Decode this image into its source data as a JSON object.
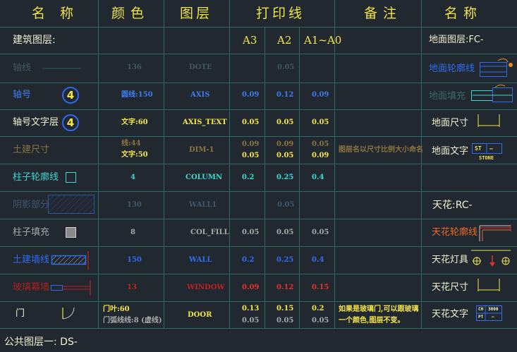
{
  "header": {
    "name_left": "名　称",
    "color": "颜 色",
    "layer": "图层",
    "print_line": "打印线",
    "note": "备 注",
    "name_right": "名 称"
  },
  "left_section_title": "建筑图层:",
  "right_section_title": "地面图层:FC-",
  "sizes": {
    "a3": "A3",
    "a2": "A2",
    "a1a0": "A1~A0"
  },
  "rows": [
    {
      "name": "轴线",
      "color": "136",
      "layer": "DOTE",
      "a3": "",
      "a2": "0.05",
      "a1": ""
    },
    {
      "name": "轴号",
      "badge": "4",
      "color": "圆线:150",
      "layer": "AXIS",
      "a3": "0.09",
      "a2": "0.12",
      "a1": "0.09"
    },
    {
      "name": "轴号文字层",
      "badge": "4",
      "color": "文字:60",
      "layer": "AXIS_TEXT",
      "a3": "0.05",
      "a2": "0.05",
      "a1": "0.05"
    },
    {
      "name": "土建尺寸",
      "color_line1": "线:44",
      "color_line2": "文字:50",
      "layer": "DIM-1",
      "a3_1": "0.09",
      "a3_2": "0.05",
      "a2_1": "0.09",
      "a2_2": "0.05",
      "a1_1": "0.05",
      "a1_2": "0.09",
      "note": "图层名以尺寸比例大小命名"
    },
    {
      "name": "柱子轮廓线",
      "color": "4",
      "layer": "COLUMN",
      "a3": "0.2",
      "a2": "0.25",
      "a1": "0.4"
    },
    {
      "name": "阴影部分",
      "color": "130",
      "layer": "WALL1",
      "a3": "",
      "a2": "0.05",
      "a1": ""
    },
    {
      "name": "柱子填充",
      "color": "8",
      "layer": "COL_FILL",
      "a3": "0.05",
      "a2": "0.05",
      "a1": "0.05"
    },
    {
      "name": "土建墙线",
      "color": "150",
      "layer": "WALL",
      "a3": "0.2",
      "a2": "0.25",
      "a1": "0.4"
    },
    {
      "name": "玻璃幕墙",
      "color": "13",
      "layer": "WINDOW",
      "a3": "0.09",
      "a2": "0.12",
      "a1": "0.15"
    },
    {
      "name": "门",
      "color_line1": "门叶:60",
      "color_line2": "门弧线线:8 (虚线)",
      "layer": "DOOR",
      "a3_1": "0.13",
      "a3_2": "0.05",
      "a2_1": "0.15",
      "a2_2": "0.05",
      "a1_1": "0.2",
      "a1_2": "0.05",
      "note_line1": "如果是玻璃门,可以跟玻璃",
      "note_line2": "一个颜色,图层不变。"
    }
  ],
  "right_items": {
    "floor_outline": "地面轮廓线",
    "floor_fill": "地面填充",
    "floor_dim": "地面尺寸",
    "floor_text": "地面文字",
    "floor_text_tag1": "ST",
    "floor_text_tag2": "—",
    "floor_text_caption": "STONE",
    "ceiling_title": "天花:RC-",
    "ceiling_outline": "天花轮廓线",
    "ceiling_lamp": "天花灯具",
    "ceiling_dim": "天花尺寸",
    "ceiling_text": "天花文字",
    "ceiling_text_tag1": "CH",
    "ceiling_text_tag2": "3000",
    "ceiling_text_tag3": "PT",
    "ceiling_text_tag4": "—"
  },
  "footer": "公共图层一: DS-"
}
